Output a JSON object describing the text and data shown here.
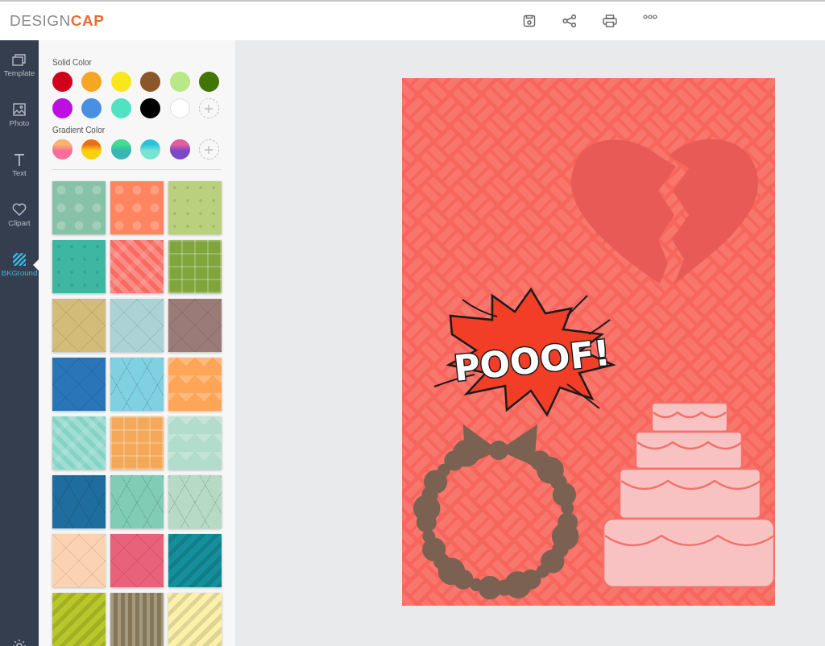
{
  "logo": {
    "prefix": "DESIGN",
    "suffix": "CAP"
  },
  "toolbar": [
    {
      "kind": "save"
    },
    {
      "kind": "share"
    },
    {
      "kind": "print"
    },
    {
      "kind": "more"
    }
  ],
  "nav": [
    {
      "kind": "template",
      "label": "Template",
      "selected": false
    },
    {
      "kind": "photo",
      "label": "Photo",
      "selected": false
    },
    {
      "kind": "text",
      "label": "Text",
      "selected": false
    },
    {
      "kind": "clipart",
      "label": "Clipart",
      "selected": false
    },
    {
      "kind": "background",
      "label": "BKGround",
      "selected": true
    }
  ],
  "panel": {
    "solid_title": "Solid Color",
    "solid": [
      {
        "color": "#d0021b"
      },
      {
        "color": "#f5a623"
      },
      {
        "color": "#f8e71c"
      },
      {
        "color": "#8b572a"
      },
      {
        "color": "#b8e986"
      },
      {
        "color": "#417505"
      },
      {
        "color": "#bd10e0"
      },
      {
        "color": "#4a90e2"
      },
      {
        "color": "#50e3c2"
      },
      {
        "color": "#000000"
      },
      {
        "color": "#ffffff"
      }
    ],
    "gradient_title": "Gradient Color",
    "gradient": [
      {
        "stops": [
          {
            "color": "#fdb56b"
          },
          {
            "color": "#f76d9b"
          }
        ]
      },
      {
        "stops": [
          {
            "color": "#ee6a1c"
          },
          {
            "color": "#fdd00d"
          }
        ]
      },
      {
        "stops": [
          {
            "color": "#43dc90"
          },
          {
            "color": "#3ab5b2"
          }
        ]
      },
      {
        "stops": [
          {
            "color": "#29c3db"
          },
          {
            "color": "#79e2d1"
          }
        ]
      },
      {
        "stops": [
          {
            "color": "#e95d9c"
          },
          {
            "color": "#7b48c8"
          }
        ]
      }
    ],
    "tiles": [
      {
        "kind": "dots",
        "color": "#86c1a8"
      },
      {
        "kind": "dots",
        "color": "#ff845f"
      },
      {
        "kind": "specks",
        "color": "#b9d17f"
      },
      {
        "kind": "specks",
        "color": "#3db7a2"
      },
      {
        "kind": "weave",
        "color": "#f86b62"
      },
      {
        "kind": "grid",
        "color": "#80a53c"
      },
      {
        "kind": "diamond",
        "color": "#d3bb7a"
      },
      {
        "kind": "diamond",
        "color": "#acd2d6"
      },
      {
        "kind": "diamond",
        "color": "#9a7b78"
      },
      {
        "kind": "diamond",
        "color": "#2a74b8"
      },
      {
        "kind": "triangle",
        "color": "#7fd0e0"
      },
      {
        "kind": "chevron",
        "color": "#ffa558"
      },
      {
        "kind": "weave",
        "color": "#85d3c6"
      },
      {
        "kind": "grid",
        "color": "#f4a95a"
      },
      {
        "kind": "chevron",
        "color": "#b2dccb"
      },
      {
        "kind": "triangle",
        "color": "#1f6d9e"
      },
      {
        "kind": "triangle",
        "color": "#80ccb5"
      },
      {
        "kind": "triangle",
        "color": "#b6dac4"
      },
      {
        "kind": "diamond",
        "color": "#fbd2b2"
      },
      {
        "kind": "diamond",
        "color": "#e86279"
      },
      {
        "kind": "stripes",
        "color": "#168f9d"
      },
      {
        "kind": "stripes",
        "color": "#b9c72a"
      },
      {
        "kind": "bars",
        "color": "#857757"
      },
      {
        "kind": "stripes",
        "color": "#fdf1a9"
      }
    ]
  },
  "design": {
    "text": "POOOF!"
  }
}
